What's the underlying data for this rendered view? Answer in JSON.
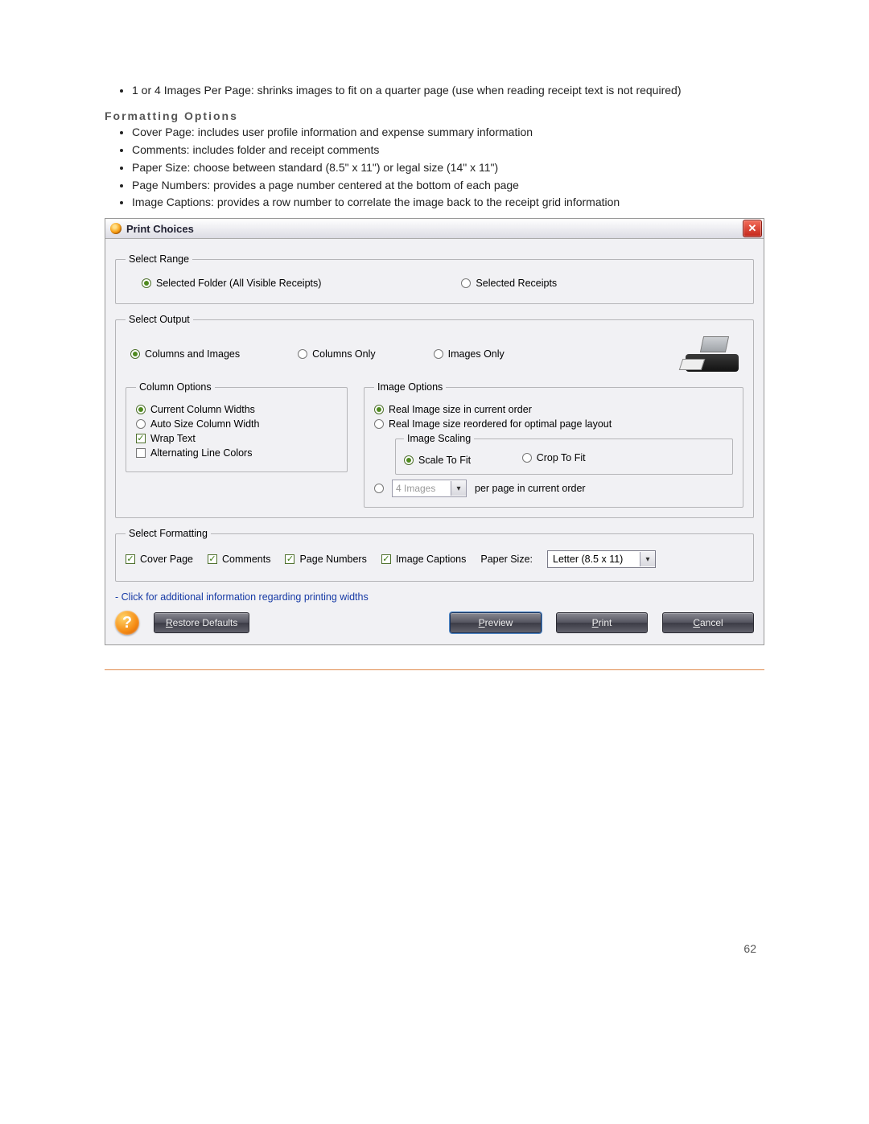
{
  "doc": {
    "bullet_above": "1 or 4 Images Per Page: shrinks images to fit on a quarter page (use when reading receipt text is not required)",
    "section_heading": "Formatting Options",
    "bullets": [
      "Cover Page: includes user profile information and expense summary information",
      "Comments: includes folder and receipt comments",
      "Paper Size: choose between standard (8.5\" x 11\") or legal size (14\" x 11\")",
      "Page Numbers: provides a page number centered at the bottom of each page",
      "Image Captions: provides a row number to correlate the image back to the receipt grid information"
    ],
    "page_number": "62"
  },
  "dialog": {
    "title": "Print Choices",
    "close_glyph": "✕",
    "select_range": {
      "legend": "Select Range",
      "opt_selected_folder": "Selected Folder (All Visible Receipts)",
      "opt_selected_receipts": "Selected Receipts"
    },
    "select_output": {
      "legend": "Select Output",
      "opt_cols_images": "Columns and Images",
      "opt_cols_only": "Columns Only",
      "opt_images_only": "Images Only"
    },
    "column_options": {
      "legend": "Column Options",
      "opt_current_widths": "Current Column Widths",
      "opt_auto_size": "Auto Size Column Width",
      "chk_wrap_text": "Wrap Text",
      "chk_alt_colors": "Alternating Line Colors"
    },
    "image_options": {
      "legend": "Image Options",
      "opt_real_current": "Real Image size in current order",
      "opt_real_reorder": "Real Image size reordered for optimal page layout",
      "scaling_legend": "Image Scaling",
      "opt_scale_fit": "Scale To Fit",
      "opt_crop_fit": "Crop To Fit",
      "combo_value": "4 Images",
      "combo_suffix": "per page in current order"
    },
    "select_formatting": {
      "legend": "Select Formatting",
      "chk_cover": "Cover Page",
      "chk_comments": "Comments",
      "chk_pagenums": "Page Numbers",
      "chk_captions": "Image Captions",
      "paper_label": "Paper Size:",
      "paper_value": "Letter (8.5 x 11)"
    },
    "link_note": "- Click for additional information regarding printing widths",
    "buttons": {
      "restore_u": "R",
      "restore_rest": "estore Defaults",
      "preview_u": "P",
      "preview_rest": "review",
      "print_u": "P",
      "print_rest": "rint",
      "cancel_u": "C",
      "cancel_rest": "ancel"
    },
    "help_glyph": "?"
  }
}
